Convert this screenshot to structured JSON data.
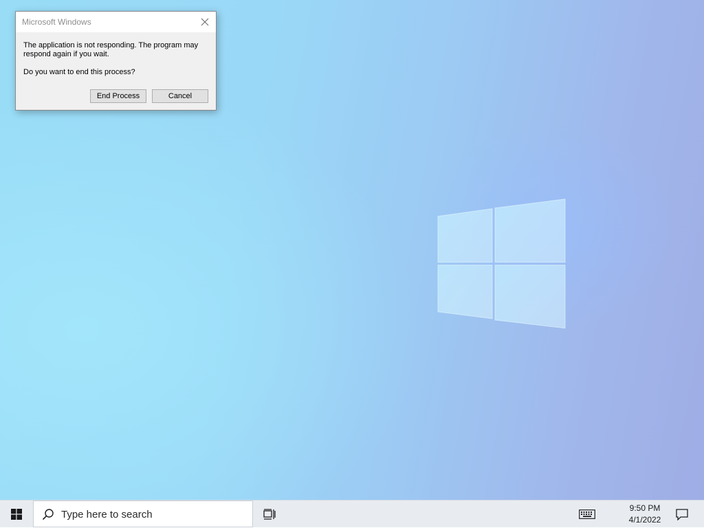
{
  "dialog": {
    "title": "Microsoft Windows",
    "message": "The application is not responding. The program may respond again if you wait.",
    "question": "Do you want to end this process?",
    "end_process_label": "End Process",
    "cancel_label": "Cancel",
    "close_icon": "close-icon"
  },
  "taskbar": {
    "start_icon": "windows-logo-icon",
    "search_placeholder": "Type here to search",
    "search_icon": "search-icon",
    "task_view_icon": "task-view-icon",
    "keyboard_icon": "keyboard-icon",
    "notification_icon": "notification-icon",
    "time": "9:50 PM",
    "date": "4/1/2022",
    "background_color": "#e8ecf1"
  },
  "desktop": {
    "wallpaper_logo_icon": "windows-logo-icon"
  }
}
